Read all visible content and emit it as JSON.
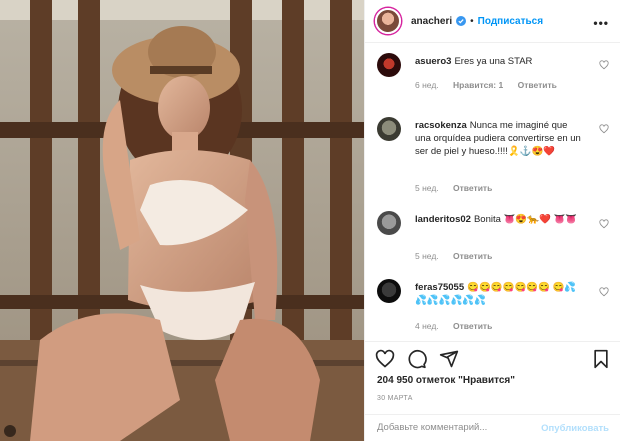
{
  "post": {
    "username": "anacheri",
    "follow_label": "Подписаться",
    "separator": "•",
    "more_glyph": "•••",
    "likes_text": "204 950 отметок \"Нравится\"",
    "date_text": "30 МАРТА"
  },
  "comments": [
    {
      "user": "asuero3",
      "text": "Eres ya una STAR",
      "age": "6 нед.",
      "likes": "Нравится: 1",
      "reply": "Ответить"
    },
    {
      "user": "racsokenza",
      "text": "Nunca me imaginé que una orquídea pudiera convertirse en un ser de piel y hueso.!!!!🎗️⚓😍❤️",
      "age": "5 нед.",
      "reply": "Ответить"
    },
    {
      "user": "landeritos02",
      "text": "Bonita 👅😍🐆❤️ 👅👅",
      "age": "5 нед.",
      "reply": "Ответить"
    },
    {
      "user": "feras75055",
      "text": "😋😋😋😋😋😋😋 😋💦💦💦💦💦💦💦",
      "age": "4 нед.",
      "reply": "Ответить"
    }
  ],
  "comment_input": {
    "placeholder": "Добавьте комментарий...",
    "value": ""
  },
  "publish_label": "Опубликовать",
  "icons": [
    "verified-badge-icon",
    "heart-icon",
    "comment-icon",
    "share-icon",
    "bookmark-icon",
    "more-icon"
  ],
  "colors": {
    "accent": "#0095f6",
    "publish_disabled": "#b2dffc",
    "muted": "#8e8e8e",
    "text": "#262626",
    "border": "#efefef"
  }
}
